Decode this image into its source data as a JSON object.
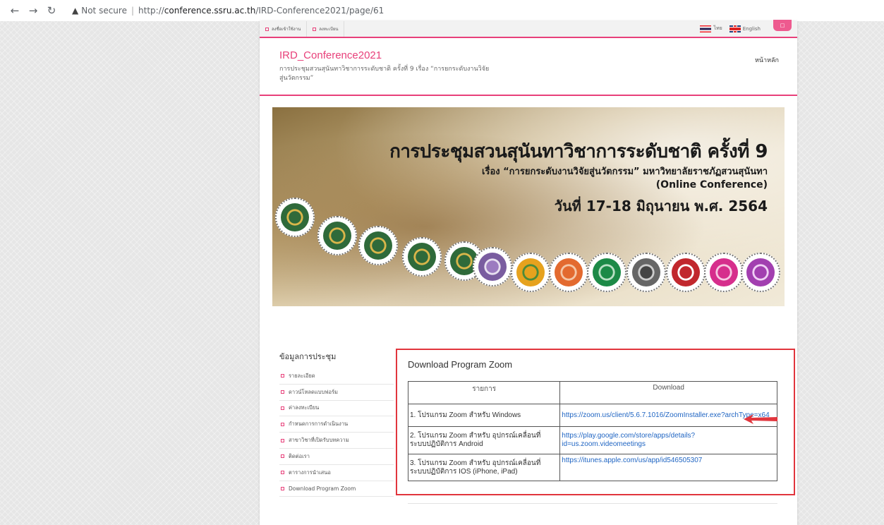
{
  "browser": {
    "back_icon": "arrow-left-icon",
    "forward_icon": "arrow-right-icon",
    "reload_icon": "reload-icon",
    "security_label": "Not secure",
    "url_proto": "http://",
    "url_host": "conference.ssru.ac.th",
    "url_path": "/IRD-Conference2021/page/61"
  },
  "topbar": {
    "login_label": "ลงชื่อเข้าใช้งาน",
    "register_label": "ลงทะเบียน",
    "lang_thai": "ไทย",
    "lang_english": "English",
    "pink_tab_label": "□"
  },
  "header": {
    "site_title": "IRD_Conference2021",
    "site_subtitle": "การประชุมสวนสุนันทาวิชาการระดับชาติ ครั้งที่ 9 เรื่อง “การยกระดับงานวิจัยสู่นวัตกรรม”",
    "home_link": "หน้าหลัก"
  },
  "banner": {
    "line1": "การประชุมสวนสุนันทาวิชาการระดับชาติ ครั้งที่ 9",
    "line2": "เรื่อง “การยกระดับงานวิจัยสู่นวัตกรรม” มหาวิทยาลัยราชภัฏสวนสุนันทา",
    "line3": "(Online Conference)",
    "line4": "วันที่ 17-18 มิถุนายน พ.ศ. 2564"
  },
  "sidebar": {
    "title": "ข้อมูลการประชุม",
    "items": [
      {
        "label": "รายละเอียด"
      },
      {
        "label": "ดาวน์โหลดแบบฟอร์ม"
      },
      {
        "label": "ค่าลงทะเบียน"
      },
      {
        "label": "กำหนดการการดำเนินงาน"
      },
      {
        "label": "สาขาวิชาที่เปิดรับบทความ"
      },
      {
        "label": "ติดต่อเรา"
      },
      {
        "label": "ตารางการนำเสนอ"
      },
      {
        "label": "Download Program Zoom"
      }
    ]
  },
  "content": {
    "title": "Download Program Zoom",
    "table": {
      "headers": [
        "รายการ",
        "Download"
      ],
      "rows": [
        {
          "item": "1. โปรแกรม Zoom สำหรับ Windows",
          "link": "https://zoom.us/client/5.6.7.1016/ZoomInstaller.exe?archType=x64"
        },
        {
          "item": "2. โปรแกรม Zoom สำหรับ อุปกรณ์เคลื่อนที่ ระบบปฏิบัติการ Android",
          "link": "https://play.google.com/store/apps/details?id=us.zoom.videomeetings"
        },
        {
          "item": "3. โปรแกรม Zoom สำหรับ อุปกรณ์เคลื่อนที่ ระบบปฏิบัติการ IOS (iPhone, iPad)",
          "link": "https://itunes.apple.com/us/app/id546505307"
        }
      ]
    }
  },
  "colors": {
    "accent": "#e8407a",
    "highlight": "#e1353d",
    "link": "#2166c3"
  }
}
